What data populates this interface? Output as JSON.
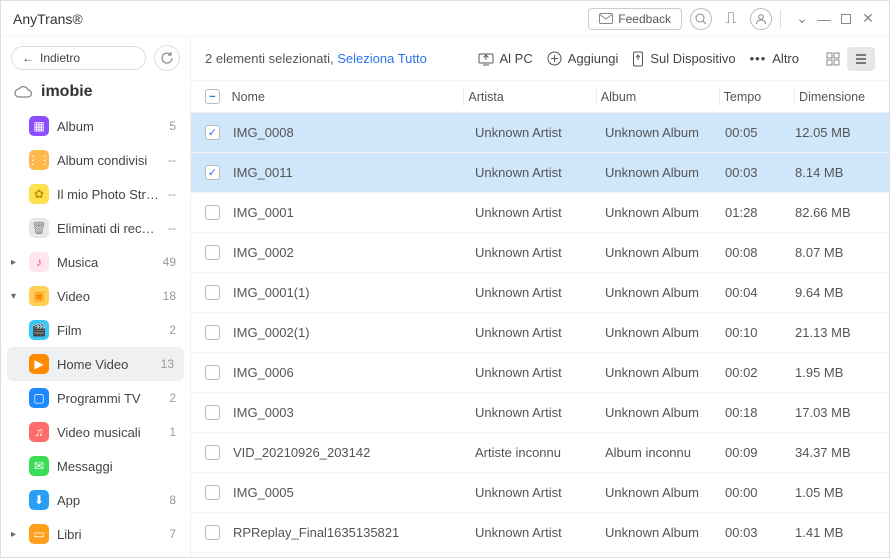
{
  "app": {
    "name": "AnyTrans®"
  },
  "titlebar": {
    "feedback": "Feedback"
  },
  "sidebar": {
    "back": "Indietro",
    "device": "imobie",
    "items": [
      {
        "label": "Album",
        "count": "5",
        "depth": 1,
        "icon_bg": "#8c4dff",
        "icon_fg": "#fff",
        "glyph": "▦"
      },
      {
        "label": "Album condivisi",
        "count": "--",
        "depth": 1,
        "icon_bg": "#ffb84d",
        "icon_fg": "#fff",
        "glyph": "⋮⋮"
      },
      {
        "label": "Il mio Photo Stream",
        "count": "--",
        "depth": 1,
        "icon_bg": "#ffe14d",
        "icon_fg": "#c59300",
        "glyph": "✿"
      },
      {
        "label": "Eliminati di recente",
        "count": "--",
        "depth": 1,
        "icon_bg": "#e8e8e8",
        "icon_fg": "#888",
        "glyph": "🗑"
      },
      {
        "label": "Musica",
        "count": "49",
        "depth": 0,
        "chev": "▸",
        "icon_bg": "#ffe5ef",
        "icon_fg": "#ff478a",
        "glyph": "♪"
      },
      {
        "label": "Video",
        "count": "18",
        "depth": 0,
        "chev": "▾",
        "icon_bg": "#ffcf5a",
        "icon_fg": "#ff8a00",
        "glyph": "▣"
      },
      {
        "label": "Film",
        "count": "2",
        "depth": 1,
        "icon_bg": "#37c8f7",
        "icon_fg": "#fff",
        "glyph": "🎬"
      },
      {
        "label": "Home Video",
        "count": "13",
        "depth": 1,
        "active": true,
        "icon_bg": "#ff8a00",
        "icon_fg": "#fff",
        "glyph": "▶"
      },
      {
        "label": "Programmi TV",
        "count": "2",
        "depth": 1,
        "icon_bg": "#1e88ff",
        "icon_fg": "#fff",
        "glyph": "▢"
      },
      {
        "label": "Video musicali",
        "count": "1",
        "depth": 1,
        "icon_bg": "#ff6a6a",
        "icon_fg": "#fff",
        "glyph": "♫"
      },
      {
        "label": "Messaggi",
        "count": "",
        "depth": 0,
        "chev": "",
        "icon_bg": "#3bdc57",
        "icon_fg": "#fff",
        "glyph": "✉"
      },
      {
        "label": "App",
        "count": "8",
        "depth": 0,
        "chev": "",
        "icon_bg": "#2a9df4",
        "icon_fg": "#fff",
        "glyph": "⬇"
      },
      {
        "label": "Libri",
        "count": "7",
        "depth": 0,
        "chev": "▸",
        "icon_bg": "#ff9f1c",
        "icon_fg": "#fff",
        "glyph": "▭"
      }
    ]
  },
  "toolbar": {
    "selection_prefix": "2 elementi selezionati, ",
    "select_all": "Seleziona Tutto",
    "to_pc": "Al PC",
    "add": "Aggiungi",
    "to_device": "Sul Dispositivo",
    "more": "Altro"
  },
  "table": {
    "headers": {
      "name": "Nome",
      "artist": "Artista",
      "album": "Album",
      "time": "Tempo",
      "size": "Dimensione"
    },
    "rows": [
      {
        "name": "IMG_0008",
        "artist": "Unknown Artist",
        "album": "Unknown Album",
        "time": "00:05",
        "size": "12.05 MB",
        "selected": true
      },
      {
        "name": "IMG_0011",
        "artist": "Unknown Artist",
        "album": "Unknown Album",
        "time": "00:03",
        "size": "8.14 MB",
        "selected": true
      },
      {
        "name": "IMG_0001",
        "artist": "Unknown Artist",
        "album": "Unknown Album",
        "time": "01:28",
        "size": "82.66 MB"
      },
      {
        "name": "IMG_0002",
        "artist": "Unknown Artist",
        "album": "Unknown Album",
        "time": "00:08",
        "size": "8.07 MB"
      },
      {
        "name": "IMG_0001(1)",
        "artist": "Unknown Artist",
        "album": "Unknown Album",
        "time": "00:04",
        "size": "9.64 MB"
      },
      {
        "name": "IMG_0002(1)",
        "artist": "Unknown Artist",
        "album": "Unknown Album",
        "time": "00:10",
        "size": "21.13 MB"
      },
      {
        "name": "IMG_0006",
        "artist": "Unknown Artist",
        "album": "Unknown Album",
        "time": "00:02",
        "size": "1.95 MB"
      },
      {
        "name": "IMG_0003",
        "artist": "Unknown Artist",
        "album": "Unknown Album",
        "time": "00:18",
        "size": "17.03 MB"
      },
      {
        "name": "VID_20210926_203142",
        "artist": "Artiste inconnu",
        "album": "Album inconnu",
        "time": "00:09",
        "size": "34.37 MB"
      },
      {
        "name": "IMG_0005",
        "artist": "Unknown Artist",
        "album": "Unknown Album",
        "time": "00:00",
        "size": "1.05 MB"
      },
      {
        "name": "RPReplay_Final1635135821",
        "artist": "Unknown Artist",
        "album": "Unknown Album",
        "time": "00:03",
        "size": "1.41 MB"
      }
    ]
  }
}
